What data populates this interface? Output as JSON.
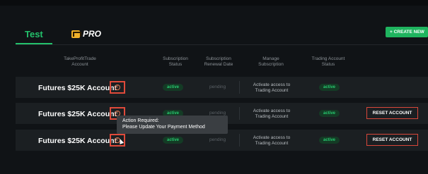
{
  "tabs": {
    "test": "Test",
    "pro": "PRO"
  },
  "create_button": "+ CREATE NEW",
  "headers": {
    "account": "TakeProfitTrade Account",
    "sub_status": "Subscription Status",
    "renewal": "Subscription Renewal Date",
    "manage": "Manage Subscription",
    "trading_status": "Trading Account Status"
  },
  "rows": [
    {
      "name": "Futures $25K Account",
      "sub_status": "active",
      "renewal": "pending",
      "manage": "Activate access to Trading Account",
      "trading_status": "active",
      "reset": ""
    },
    {
      "name": "Futures $25K Account",
      "sub_status": "active",
      "renewal": "pending",
      "manage": "Activate access to Trading Account",
      "trading_status": "active",
      "reset": "RESET ACCOUNT"
    },
    {
      "name": "Futures $25K Account",
      "sub_status": "active",
      "renewal": "pending",
      "manage": "Activate access to Trading Account",
      "trading_status": "active",
      "reset": "RESET ACCOUNT"
    }
  ],
  "tooltip": {
    "line1": "Action Required:",
    "line2": "Please Update Your Payment Method"
  },
  "colors": {
    "accent": "#23c16b",
    "warning": "#e04a3a",
    "badge_bg": "#143b25"
  }
}
